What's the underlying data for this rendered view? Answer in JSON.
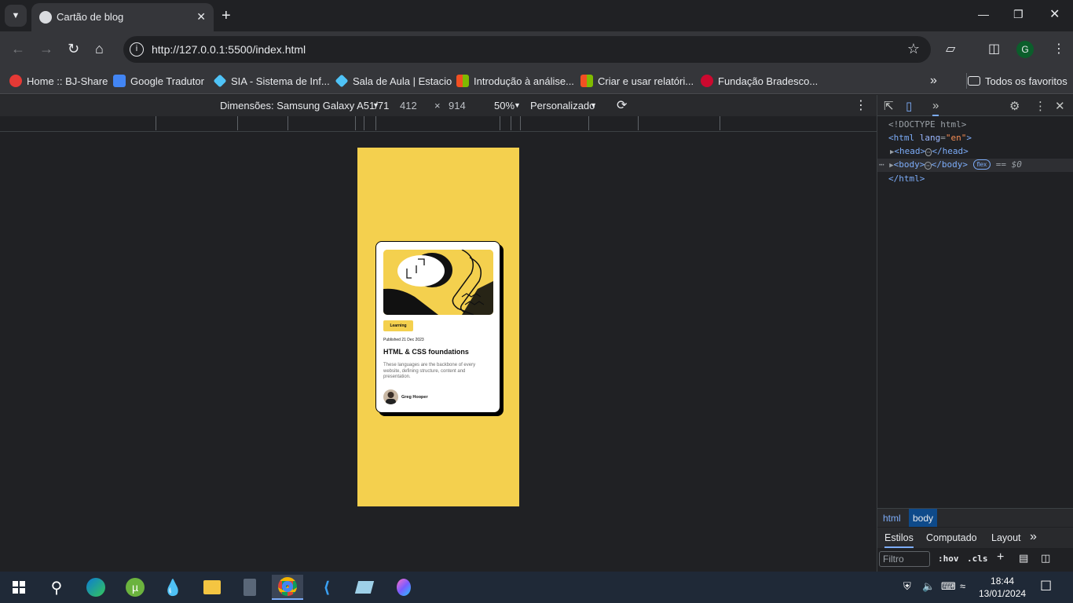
{
  "browser": {
    "tab_title": "Cartão de blog",
    "url": "http://127.0.0.1:5500/index.html",
    "profile_initial": "G"
  },
  "bookmarks": {
    "items": [
      {
        "label": "Home :: BJ-Share",
        "color": "#e53935"
      },
      {
        "label": "Google Tradutor",
        "color": "#4285f4"
      },
      {
        "label": "SIA - Sistema de Inf...",
        "color": "#4fc3f7"
      },
      {
        "label": "Sala de Aula | Estacio",
        "color": "#4fc3f7"
      },
      {
        "label": "Introdução à análise...",
        "color": "#f25022"
      },
      {
        "label": "Criar e usar relatóri...",
        "color": "#f25022"
      },
      {
        "label": "Fundação Bradesco...",
        "color": "#cc092f"
      }
    ],
    "all_label": "Todos os favoritos"
  },
  "device_toolbar": {
    "device": "Dimensões: Samsung Galaxy A51/71",
    "width": "412",
    "times": "×",
    "height": "914",
    "zoom": "50%",
    "throttle": "Personalizado"
  },
  "card": {
    "tag": "Learning",
    "published": "Published 21 Dec 2023",
    "title": "HTML & CSS foundations",
    "description": "These languages are the backbone of every website, defining structure, content and presentation.",
    "author": "Greg Hooper",
    "page_bg": "#f4d04e"
  },
  "devtools": {
    "doctype": "<!DOCTYPE html>",
    "html_open_tag": "<html",
    "html_attr_name": "lang",
    "html_attr_value": "\"en\"",
    "html_open_close": ">",
    "head_line": "<head>",
    "head_close": "</head>",
    "body_line": "<body>",
    "body_close": "</body>",
    "flex_badge": "flex",
    "selected_marker": "== $0",
    "html_close": "</html>",
    "crumbs": [
      "html",
      "body"
    ],
    "tabs": [
      "Estilos",
      "Computado",
      "Layout"
    ],
    "filter_placeholder": "Filtro",
    "hov": ":hov",
    "cls": ".cls"
  },
  "taskbar": {
    "time": "18:44",
    "date": "13/01/2024"
  }
}
